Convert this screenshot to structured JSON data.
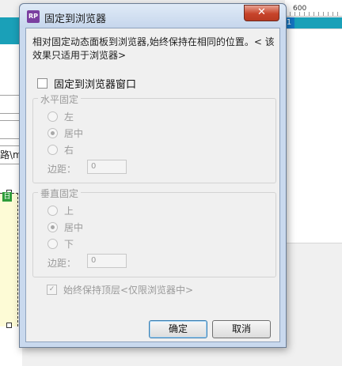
{
  "background": {
    "ruler_label": "600",
    "badge": "1",
    "field_text": "路\\me",
    "green_icon": "日"
  },
  "dialog": {
    "app_icon": "RP",
    "title": "固定到浏览器",
    "close_label": "✕",
    "description": "相对固定动态面板到浏览器,始终保持在相同的位置。< 该效果只适用于浏览器>",
    "pin_checkbox": {
      "label": "固定到浏览器窗口",
      "checked": false
    },
    "horizontal": {
      "legend": "水平固定",
      "options": [
        "左",
        "居中",
        "右"
      ],
      "selected": "居中",
      "margin_label": "边距：",
      "margin_value": "0"
    },
    "vertical": {
      "legend": "垂直固定",
      "options": [
        "上",
        "居中",
        "下"
      ],
      "selected": "居中",
      "margin_label": "边距：",
      "margin_value": "0"
    },
    "top_checkbox": {
      "label": "始终保持顶层<仅限浏览器中>",
      "checked": true
    },
    "ok_label": "确定",
    "cancel_label": "取消"
  },
  "colors": {
    "title_bar": "#c6d6ec",
    "close_button": "#c7432a",
    "accent_teal": "#1aa0b8",
    "disabled_text": "#9a9a9a"
  }
}
